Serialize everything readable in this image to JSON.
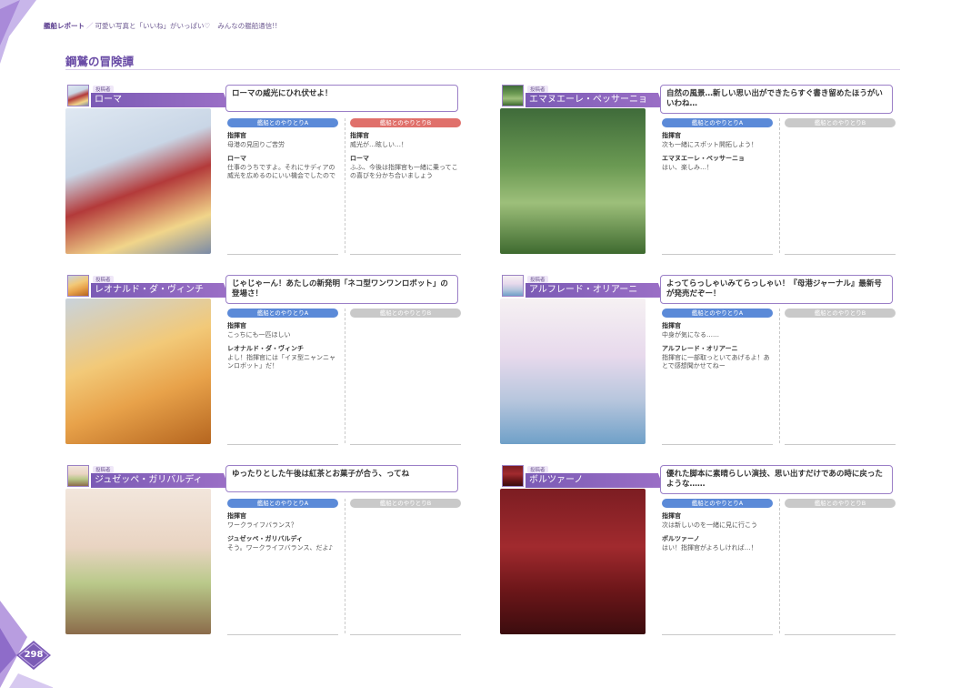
{
  "header": {
    "main": "艦船レポート",
    "separator": "／",
    "sub": "可愛い写真と「いいね」がいっぱい♡",
    "sub2": "みんなの艦船通信!!"
  },
  "section": {
    "title": "鋼鷲の冒険譚"
  },
  "labels": {
    "poster_tag": "投稿者",
    "pill_a": "艦船とのやりとりA",
    "pill_b": "艦船とのやりとりB"
  },
  "page_number": "298",
  "cards": [
    {
      "name": "ローマ",
      "message": "ローマの威光にひれ伏せよ！",
      "a": {
        "lines": [
          {
            "speaker": "指揮官",
            "text": "母港の見回りご苦労"
          },
          {
            "speaker": "ローマ",
            "text": "仕事のうちですよ。それにサディアの威光を広めるのにいい機会でしたので"
          }
        ]
      },
      "b": {
        "lines": [
          {
            "speaker": "指揮官",
            "text": "威光が…眩しい…！"
          },
          {
            "speaker": "ローマ",
            "text": "ふふ、今後は指揮官も一緒に乗ってこの喜びを分かち合いましょう"
          }
        ]
      }
    },
    {
      "name": "エマヌエーレ・ペッサーニョ",
      "message": "自然の風景…新しい思い出ができたらすぐ書き留めたほうがいいわね…",
      "a": {
        "lines": [
          {
            "speaker": "指揮官",
            "text": "次も一緒にスポット開拓しよう！"
          },
          {
            "speaker": "エマヌエーレ・ペッサーニョ",
            "text": "はい、楽しみ…！"
          }
        ]
      },
      "b": {
        "lines": []
      }
    },
    {
      "name": "レオナルド・ダ・ヴィンチ",
      "message": "じゃじゃーん！あたしの新発明「ネコ型ワンワンロボット」の登場さ！",
      "a": {
        "lines": [
          {
            "speaker": "指揮官",
            "text": "こっちにも一匹ほしい"
          },
          {
            "speaker": "レオナルド・ダ・ヴィンチ",
            "text": "よし！指揮官には「イヌ型ニャンニャンロボット」だ！"
          }
        ]
      },
      "b": {
        "lines": []
      }
    },
    {
      "name": "アルフレード・オリアーニ",
      "message": "よってらっしゃいみてらっしゃい！『母港ジャーナル』最新号が発売だぞー！",
      "a": {
        "lines": [
          {
            "speaker": "指揮官",
            "text": "中身が気になる……"
          },
          {
            "speaker": "アルフレード・オリアーニ",
            "text": "指揮官に一部取っといてあげるよ！あとで感想聞かせてねー"
          }
        ]
      },
      "b": {
        "lines": []
      }
    },
    {
      "name": "ジュゼッペ・ガリバルディ",
      "message": "ゆったりとした午後は紅茶とお菓子が合う、ってね",
      "a": {
        "lines": [
          {
            "speaker": "指揮官",
            "text": "ワークライフバランス？"
          },
          {
            "speaker": "ジュゼッペ・ガリバルディ",
            "text": "そう。ワークライフバランス、だよ♪"
          }
        ]
      },
      "b": {
        "lines": []
      }
    },
    {
      "name": "ボルツァーノ",
      "message": "優れた脚本に素晴らしい演技、思い出すだけであの時に戻ったような……",
      "a": {
        "lines": [
          {
            "speaker": "指揮官",
            "text": "次は新しいのを一緒に見に行こう"
          },
          {
            "speaker": "ボルツァーノ",
            "text": "はい！指揮官がよろしければ…！"
          }
        ]
      },
      "b": {
        "lines": []
      }
    }
  ]
}
